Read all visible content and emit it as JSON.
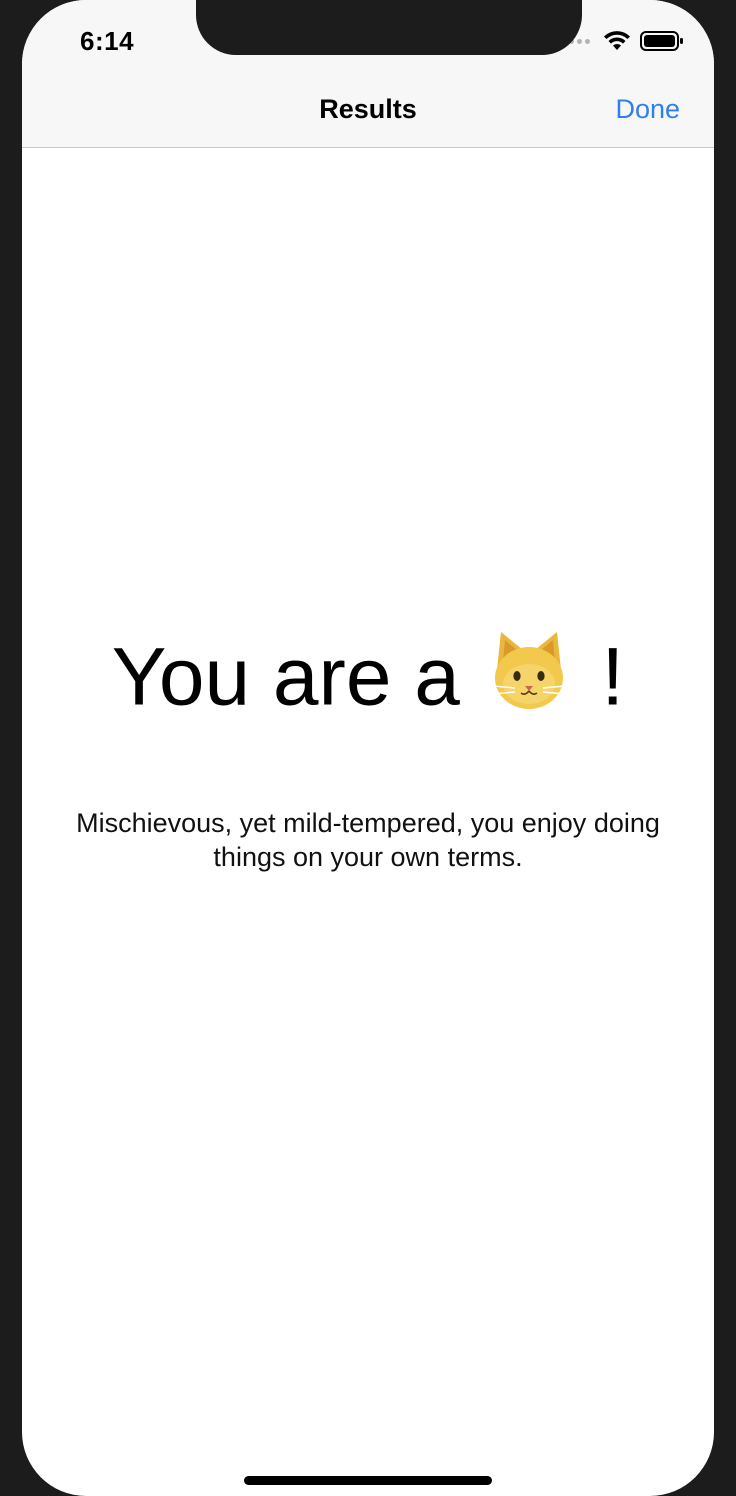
{
  "status_bar": {
    "time": "6:14"
  },
  "navbar": {
    "title": "Results",
    "done_label": "Done"
  },
  "result": {
    "heading_prefix": "You are a",
    "heading_suffix": "!",
    "emoji_icon": "cat-face-icon",
    "description": "Mischievous, yet mild-tempered, you enjoy doing things on your own terms."
  },
  "colors": {
    "accent": "#2f7ff0",
    "bar_background": "#f7f7f7",
    "frame": "#1c1c1c"
  }
}
